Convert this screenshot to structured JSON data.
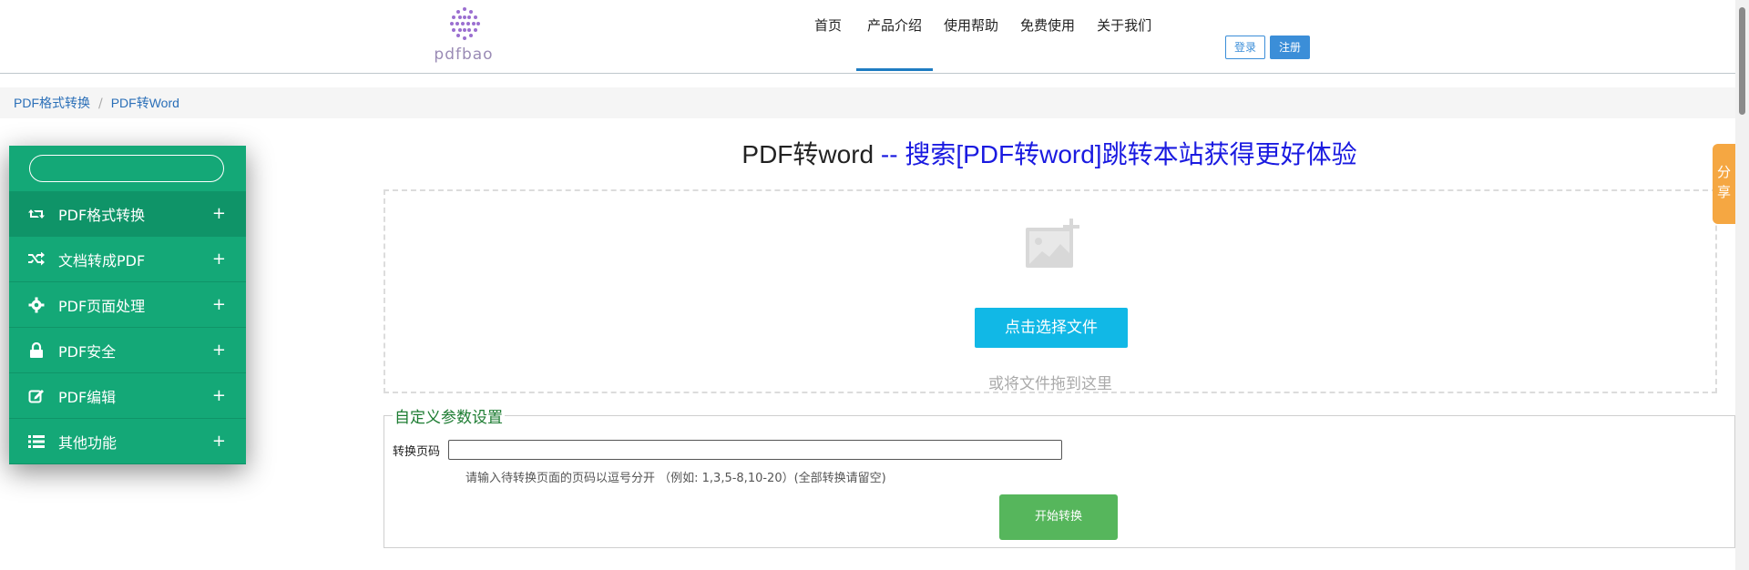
{
  "header": {
    "logo_text": "pdfbao",
    "nav": [
      {
        "label": "首页"
      },
      {
        "label": "产品介绍"
      },
      {
        "label": "使用帮助"
      },
      {
        "label": "免费使用"
      },
      {
        "label": "关于我们"
      }
    ],
    "active_nav": "产品介绍",
    "login_label": "登录",
    "register_label": "注册"
  },
  "breadcrumb": {
    "items": [
      "PDF格式转换",
      "PDF转Word"
    ],
    "separator": "/"
  },
  "sidebar": {
    "search_placeholder": "",
    "items": [
      {
        "label": "PDF格式转换",
        "icon": "retweet-icon",
        "expand": "+"
      },
      {
        "label": "文档转成PDF",
        "icon": "shuffle-icon",
        "expand": "+"
      },
      {
        "label": "PDF页面处理",
        "icon": "gear-icon",
        "expand": "+"
      },
      {
        "label": "PDF安全",
        "icon": "lock-icon",
        "expand": "+"
      },
      {
        "label": "PDF编辑",
        "icon": "edit-icon",
        "expand": "+"
      },
      {
        "label": "其他功能",
        "icon": "list-icon",
        "expand": "+"
      }
    ]
  },
  "main": {
    "title_main": "PDF转word",
    "title_promo": " -- 搜索[PDF转word]跳转本站获得更好体验",
    "choose_file_label": "点击选择文件",
    "drop_hint": "或将文件拖到这里",
    "settings_title": "自定义参数设置",
    "pages_label": "转换页码",
    "pages_value": "",
    "pages_hint": "请输入待转换页面的页码以逗号分开 （例如: 1,3,5-8,10-20）(全部转换请留空)",
    "start_label": "开始转换"
  },
  "share_label": "分享",
  "colors": {
    "sidebar": "#14a877",
    "nav_accent": "#1f7cc2",
    "choose_button": "#11b8e6",
    "start_button": "#56b65c",
    "promo_text": "#1a1ae0",
    "share_tab": "#f5a742"
  }
}
